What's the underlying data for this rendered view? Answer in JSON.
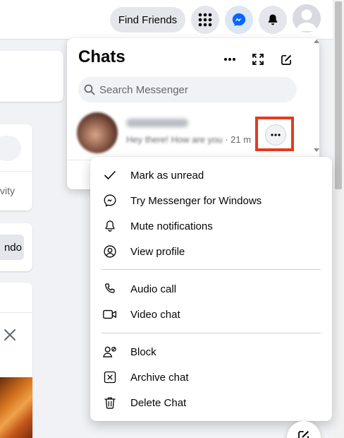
{
  "topbar": {
    "find_friends_label": "Find Friends",
    "menu_icon": "grid-menu-icon",
    "messenger_icon": "messenger-icon",
    "notifications_icon": "bell-icon",
    "account_icon": "profile-avatar-icon"
  },
  "background": {
    "left_text_1": "vity",
    "left_button_label": "ndo"
  },
  "chats": {
    "title": "Chats",
    "header_icons": [
      "more-options-icon",
      "expand-icon",
      "new-message-icon"
    ],
    "search_placeholder": "Search Messenger",
    "conversation": {
      "snippet_start": "Hey there! How are you",
      "snippet_time": " · 21 m"
    }
  },
  "context_menu": {
    "items": [
      {
        "label": "Mark as unread",
        "icon": "checkmark-icon"
      },
      {
        "label": "Try Messenger for Windows",
        "icon": "messenger-icon"
      },
      {
        "label": "Mute notifications",
        "icon": "bell-icon"
      },
      {
        "label": "View profile",
        "icon": "user-circle-icon"
      },
      {
        "label": "Audio call",
        "icon": "phone-icon"
      },
      {
        "label": "Video chat",
        "icon": "video-camera-icon"
      },
      {
        "label": "Block",
        "icon": "block-user-icon"
      },
      {
        "label": "Archive chat",
        "icon": "archive-icon"
      },
      {
        "label": "Delete Chat",
        "icon": "trash-icon"
      }
    ]
  },
  "colors": {
    "highlight_box": "#e33b1f",
    "messenger_blue": "#0866ff",
    "page_bg": "#f0f2f5"
  }
}
